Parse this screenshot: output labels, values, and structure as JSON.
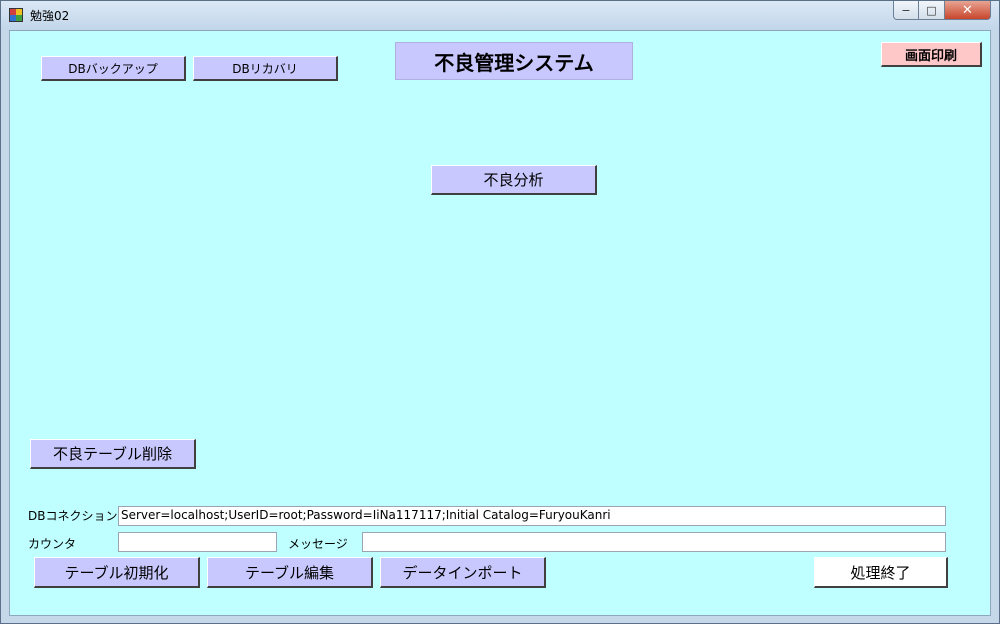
{
  "window": {
    "title": "勉強02",
    "minimize": "−",
    "maximize": "□",
    "close": "✕"
  },
  "header": {
    "system_title": "不良管理システム",
    "db_backup_label": "DBバックアップ",
    "db_recovery_label": "DBリカバリ",
    "print_screen_label": "画面印刷"
  },
  "main": {
    "defect_analysis_label": "不良分析",
    "delete_defect_table_label": "不良テーブル削除"
  },
  "footer": {
    "db_connection_label": "DBコネクション",
    "db_connection_value": "Server=localhost;UserID=root;Password=IiNa117117;Initial Catalog=FuryouKanri",
    "counter_label": "カウンタ",
    "counter_value": "",
    "message_label": "メッセージ",
    "message_value": "",
    "init_table_label": "テーブル初期化",
    "edit_table_label": "テーブル編集",
    "data_import_label": "データインポート",
    "end_process_label": "処理終了"
  },
  "colors": {
    "client_bg": "#c0ffff",
    "button_bg": "#c8c8ff",
    "print_button_bg": "#ffc8c8"
  }
}
